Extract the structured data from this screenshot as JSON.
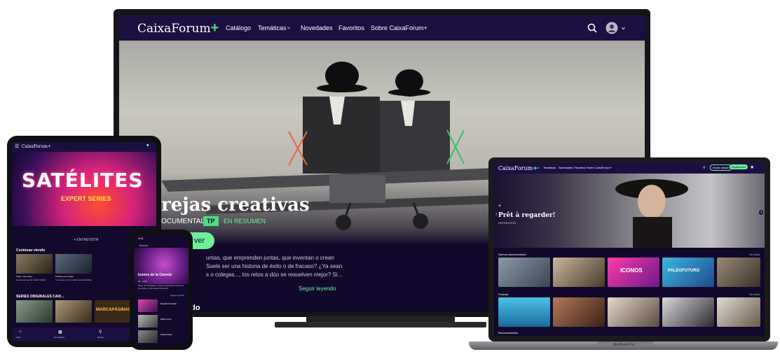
{
  "brand": {
    "name": "CaixaForum",
    "plus": "+",
    "accent": "#4ade80",
    "bg": "#12082b"
  },
  "tv": {
    "nav": [
      {
        "label": "Catálogo"
      },
      {
        "label": "Temáticas"
      },
      {
        "label": "Novedades"
      },
      {
        "label": "Favoritos"
      },
      {
        "label": "Sobre CaixaForum+"
      }
    ],
    "hero_title": "rejas creativas",
    "genre": "OCUMENTAL",
    "rating_badge": "TP",
    "summary_link": "EN RESUMEN",
    "cta": "mpezar a ver",
    "description": [
      "untas, que emprenden juntas, que inventan o crean",
      "Suele ser una historia de éxito o de fracaso? ¿Ya sean",
      "s o colegas..., los retos a dúo se resuelven mejor? Si..."
    ],
    "read_more": "Seguir leyendo",
    "section_peek": "ado"
  },
  "laptop": {
    "nav": [
      "Inicio",
      "Temáticas",
      "Novedades",
      "Favoritos",
      "Sobre CaixaForum+"
    ],
    "btn_login": "Iniciar sesión",
    "btn_signup": "Registrarse",
    "hero_title": "Prêt à regarder!",
    "hero_genre": "ENTREVISTA",
    "rows": [
      {
        "title": "Nuevos documentales",
        "more": "Ver todo",
        "featured": "ICONOS",
        "featured2": "PALEOFUTURO"
      },
      {
        "title": "Podcast",
        "more": "Ver todo"
      },
      {
        "title": "Recomendados"
      }
    ],
    "base_label": "MacBook Pro"
  },
  "tablet": {
    "brand": "CaixaForum+",
    "hero_title": "SATÉLITES",
    "hero_subtitle": "EXPERT SERIES",
    "hero_tag": "+ ENTREVISTA",
    "continue_title": "Continuar viendo",
    "cards": [
      {
        "title": "Gaya, 3 de mayo",
        "subtitle": "La tercera vez de Carlos Muñoz"
      },
      {
        "title": "Pulsear por el cielo",
        "subtitle": "Un paseo por la ciudad de las estrellas"
      }
    ],
    "series_title": "SERIES ORIGINALES CAIX...",
    "series_card": "MARCAPÁGINAS",
    "tabbar": [
      "Inicio",
      "Novedades",
      "Buscar"
    ]
  },
  "phone": {
    "time": "9:41",
    "search": "Buscar",
    "title": "Iconos de la Ciencia",
    "meta": "E1 · 2023",
    "description": "Serie de divulgación sobre los grandes iconos de la ciencia y sus descubrimientos",
    "more": "Seguir leyendo",
    "episodes": [
      {
        "title": "Rosalind Franklin"
      },
      {
        "title": "Marie Curie"
      },
      {
        "title": "Nikola Tesla"
      }
    ]
  }
}
